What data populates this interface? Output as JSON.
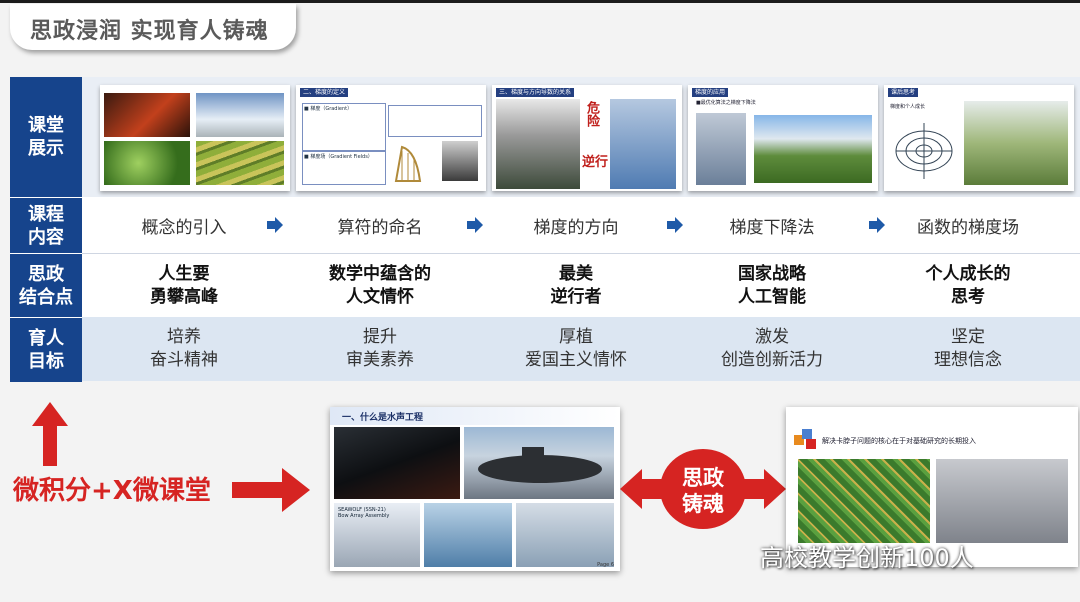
{
  "title": "思政浸润 实现育人铸魂",
  "row_labels": {
    "classroom": "课堂\n展示",
    "content": "课程\n内容",
    "ideological": "思政\n结合点",
    "goal": "育人\n目标"
  },
  "thumbnails": [
    {
      "header": ""
    },
    {
      "header": "二、梯度的定义",
      "line1": "■ 梯度（Gradient）",
      "line2": "■ 梯度场（Gradient Fields）"
    },
    {
      "header": "三、梯度与方向导数的关系",
      "line1": "危险",
      "line2": "逆行"
    },
    {
      "header": "梯度的应用",
      "line1": "■最优化算法之梯度下降法"
    },
    {
      "header": "课后思考",
      "line1": "梯度和个人成长"
    }
  ],
  "columns": [
    {
      "content": "概念的引入",
      "ideo": "人生要\n勇攀高峰",
      "goal": "培养\n奋斗精神"
    },
    {
      "content": "算符的命名",
      "ideo": "数学中蕴含的\n人文情怀",
      "goal": "提升\n审美素养"
    },
    {
      "content": "梯度的方向",
      "ideo": "最美\n逆行者",
      "goal": "厚植\n爱国主义情怀"
    },
    {
      "content": "梯度下降法",
      "ideo": "国家战略\n人工智能",
      "goal": "激发\n创造创新活力"
    },
    {
      "content": "函数的梯度场",
      "ideo": "个人成长的\n思考",
      "goal": "坚定\n理想信念"
    }
  ],
  "bottom": {
    "left_label": "微积分+X微课堂",
    "center_slide_title": "一、什么是水声工程",
    "center_slide_sub": "SEAWOLF (SSN-21)\nBow Array Assembly",
    "center_slide_page": "Page 6",
    "oval_text": "思政\n铸魂",
    "right_slide_title": "解决卡脖子问题的核心在于对基础研究的长期投入"
  },
  "watermark": "高校教学创新100人",
  "colors": {
    "row_label_bg": "#16448c",
    "accent_red": "#d62422",
    "arrow_blue": "#1e5aa8"
  }
}
